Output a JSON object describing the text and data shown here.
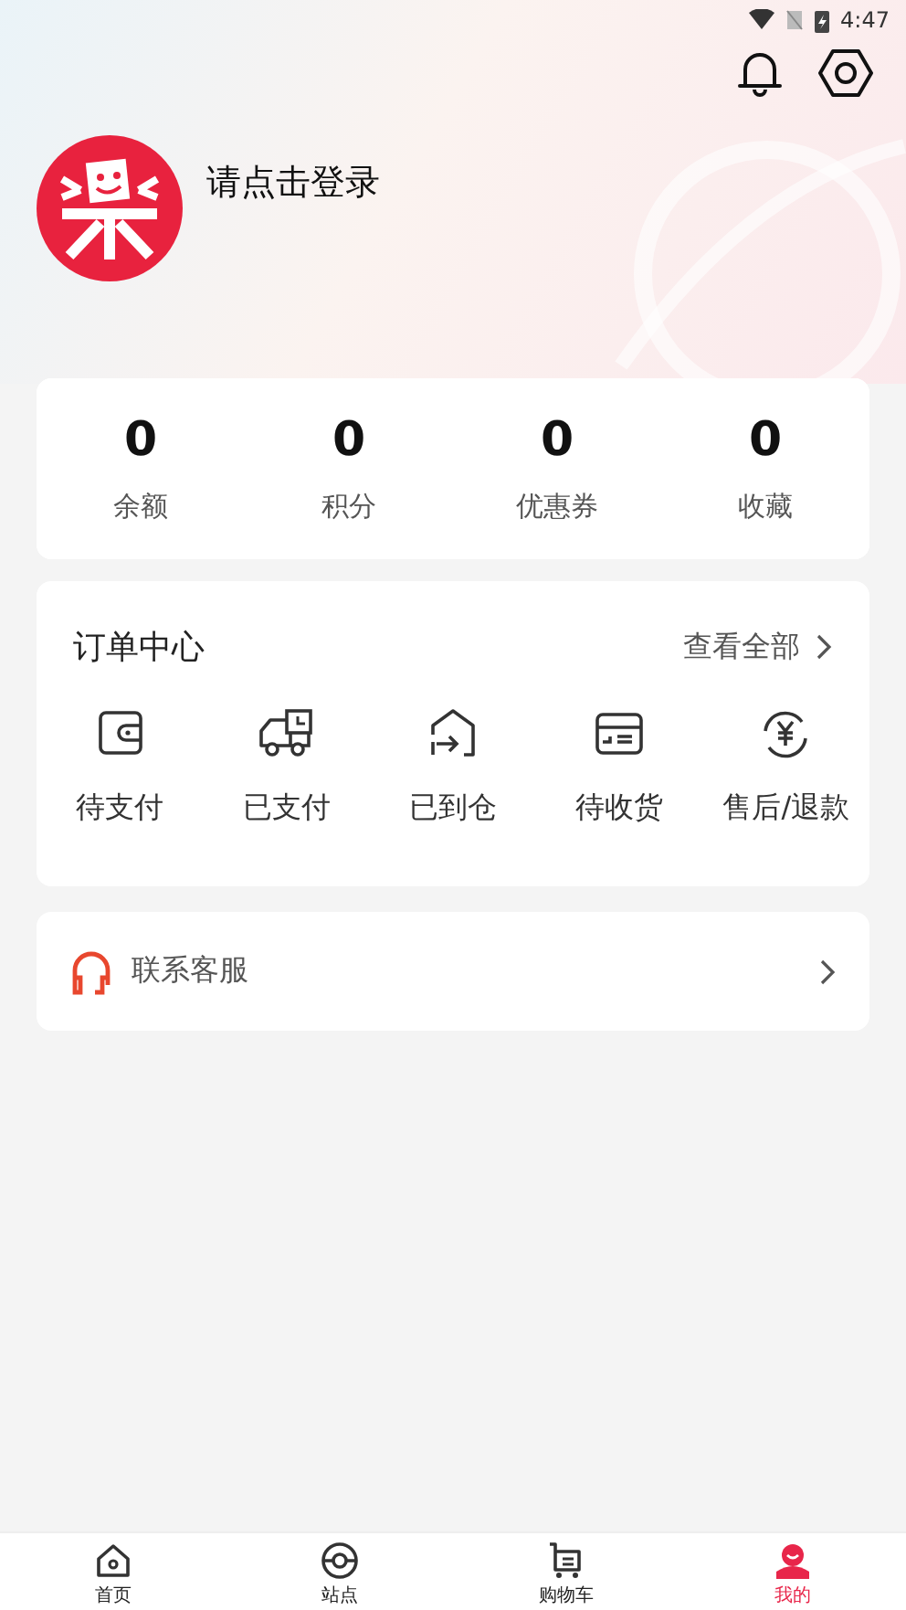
{
  "status_bar": {
    "time": "4:47"
  },
  "header": {
    "login_prompt": "请点击登录"
  },
  "stats": [
    {
      "value": "0",
      "label": "余额"
    },
    {
      "value": "0",
      "label": "积分"
    },
    {
      "value": "0",
      "label": "优惠券"
    },
    {
      "value": "0",
      "label": "收藏"
    }
  ],
  "orders": {
    "title": "订单中心",
    "view_all": "查看全部",
    "items": [
      {
        "label": "待支付",
        "kind": "wallet"
      },
      {
        "label": "已支付",
        "kind": "truck"
      },
      {
        "label": "已到仓",
        "kind": "warehouse"
      },
      {
        "label": "待收货",
        "kind": "box"
      },
      {
        "label": "售后/退款",
        "kind": "refund"
      }
    ]
  },
  "service": {
    "label": "联系客服"
  },
  "tab_bar": [
    {
      "label": "首页",
      "kind": "home",
      "selected": false
    },
    {
      "label": "站点",
      "kind": "station",
      "selected": false
    },
    {
      "label": "购物车",
      "kind": "cart",
      "selected": false
    },
    {
      "label": "我的",
      "kind": "me",
      "selected": true
    }
  ]
}
